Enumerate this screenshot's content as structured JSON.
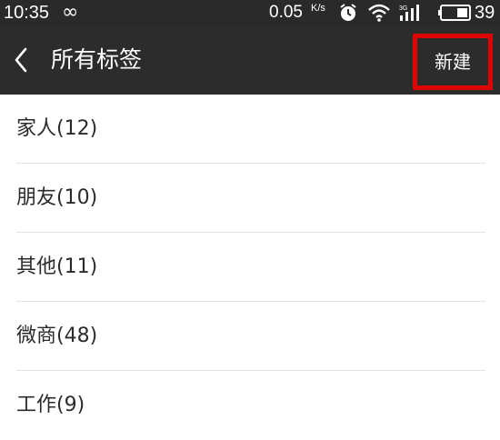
{
  "status_bar": {
    "time": "10:35",
    "loop_symbol": "∞",
    "net_speed": "0.05",
    "net_speed_unit": "K/s",
    "battery_level": "39"
  },
  "app_bar": {
    "title": "所有标签",
    "new_button_label": "新建"
  },
  "tags": [
    {
      "label": "家人(12)"
    },
    {
      "label": "朋友(10)"
    },
    {
      "label": "其他(11)"
    },
    {
      "label": "微商(48)"
    },
    {
      "label": "工作(9)"
    }
  ],
  "colors": {
    "bar_background": "#2c2c2c",
    "highlight_border": "#e00000"
  }
}
